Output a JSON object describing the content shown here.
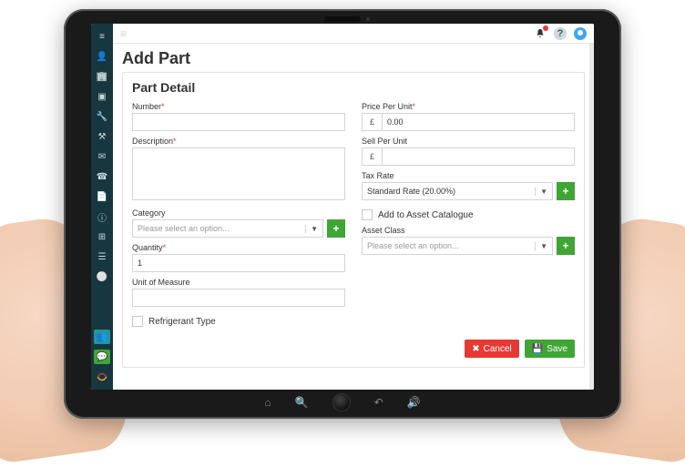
{
  "header": {
    "title": "Add Part"
  },
  "card": {
    "title": "Part Detail"
  },
  "left": {
    "number_label": "Number",
    "description_label": "Description",
    "category_label": "Category",
    "category_placeholder": "Please select an option...",
    "quantity_label": "Quantity",
    "quantity_value": "1",
    "unit_label": "Unit of Measure",
    "refrigerant_label": "Refrigerant Type"
  },
  "right": {
    "price_label": "Price Per Unit",
    "price_value": "0.00",
    "sell_label": "Sell Per Unit",
    "tax_label": "Tax Rate",
    "tax_value": "Standard Rate (20.00%)",
    "add_asset_label": "Add to Asset Catalogue",
    "asset_class_label": "Asset Class",
    "asset_class_placeholder": "Please select an option..."
  },
  "currency": "£",
  "actions": {
    "cancel": "Cancel",
    "save": "Save"
  },
  "sidebar_icons": [
    "bars-icon",
    "user-icon",
    "building-icon",
    "wrench-icon",
    "folder-icon",
    "tools-icon",
    "mail-icon",
    "phone-icon",
    "file-icon",
    "info-icon",
    "tag-icon",
    "package-icon",
    "users2-icon"
  ],
  "topbar": {}
}
